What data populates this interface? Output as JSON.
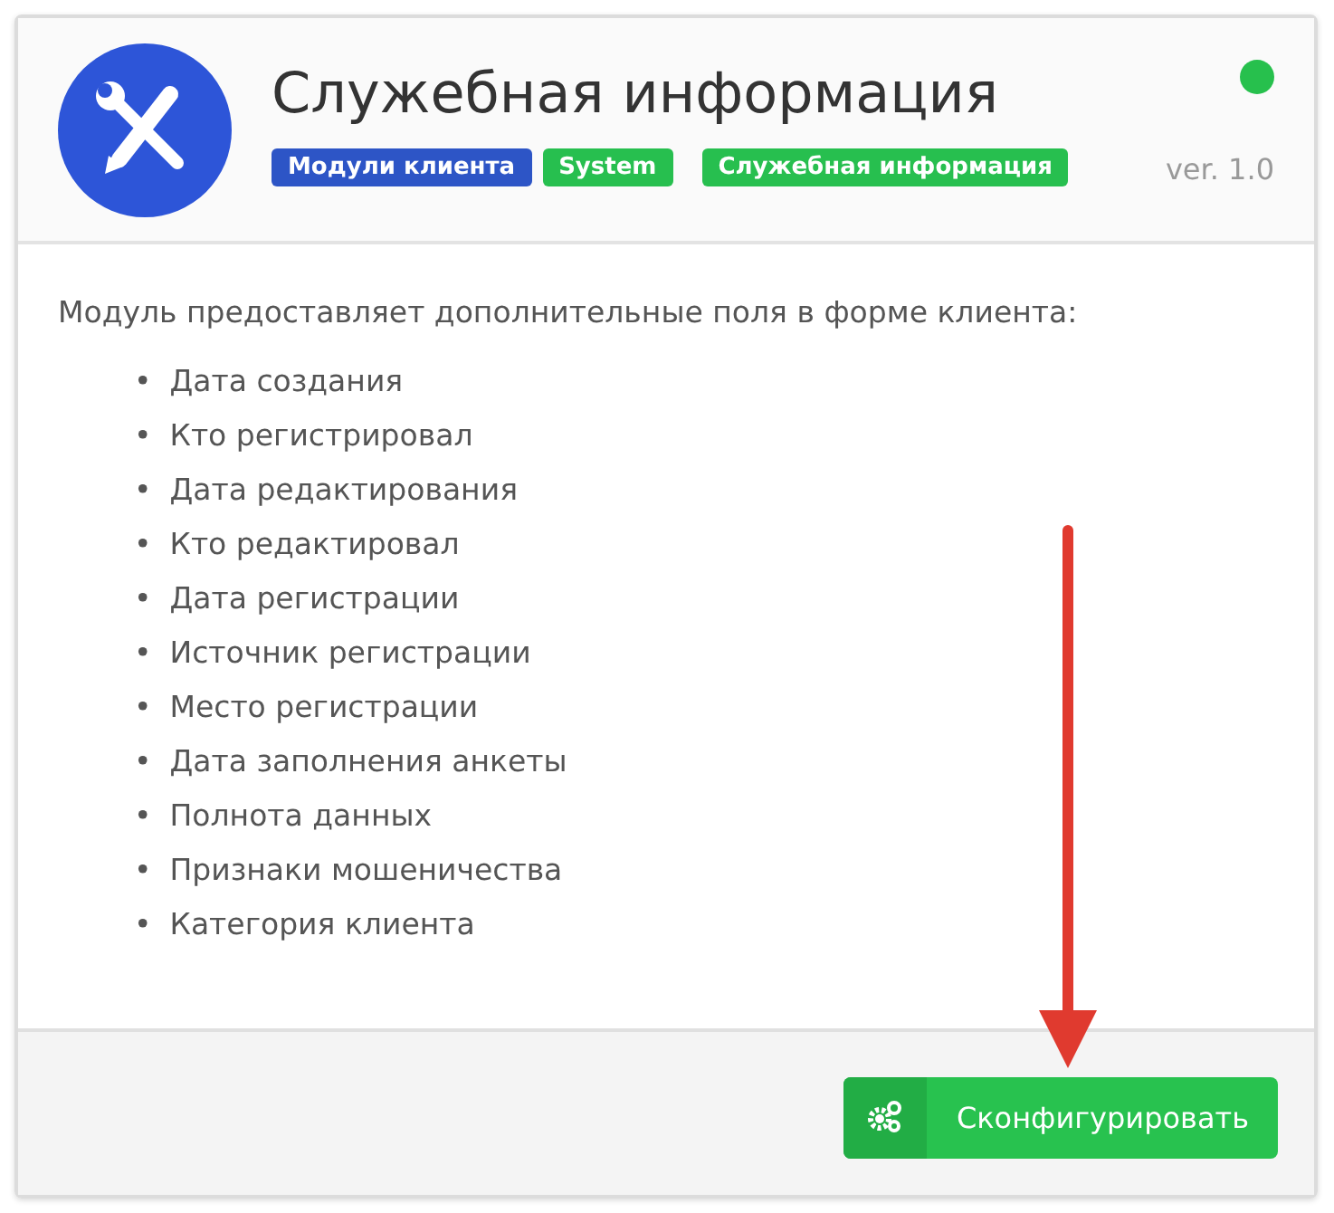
{
  "module": {
    "title": "Служебная информация",
    "active": true,
    "version": "ver. 1.0",
    "tags": [
      {
        "label": "Модули клиента",
        "color": "#2d55c6"
      },
      {
        "label": "System",
        "color": "#27bf4f"
      },
      {
        "label": "Служебная информация",
        "color": "#27bf4f"
      }
    ],
    "description": "Модуль предоставляет дополнительные поля в форме клиента:",
    "fields": [
      {
        "bullet": "•",
        "text": "Дата создания"
      },
      {
        "bullet": "•",
        "text": "Кто регистрировал"
      },
      {
        "bullet": "•",
        "text": "Дата редактирования"
      },
      {
        "bullet": "•",
        "text": "Кто редактировал"
      },
      {
        "bullet": "•",
        "text": "Дата регистрации"
      },
      {
        "bullet": "•",
        "text": "Источник регистрации"
      },
      {
        "bullet": "•",
        "text": "Место регистрации"
      },
      {
        "bullet": "•",
        "text": "Дата заполнения анкеты"
      },
      {
        "bullet": "•",
        "text": "Полнота данных"
      },
      {
        "bullet": "•",
        "text": "Признаки мошеничества"
      },
      {
        "bullet": "•",
        "text": "Категория клиента"
      }
    ],
    "configure_button": "Сконфигурировать"
  },
  "annotation": {
    "kind": "arrow"
  }
}
